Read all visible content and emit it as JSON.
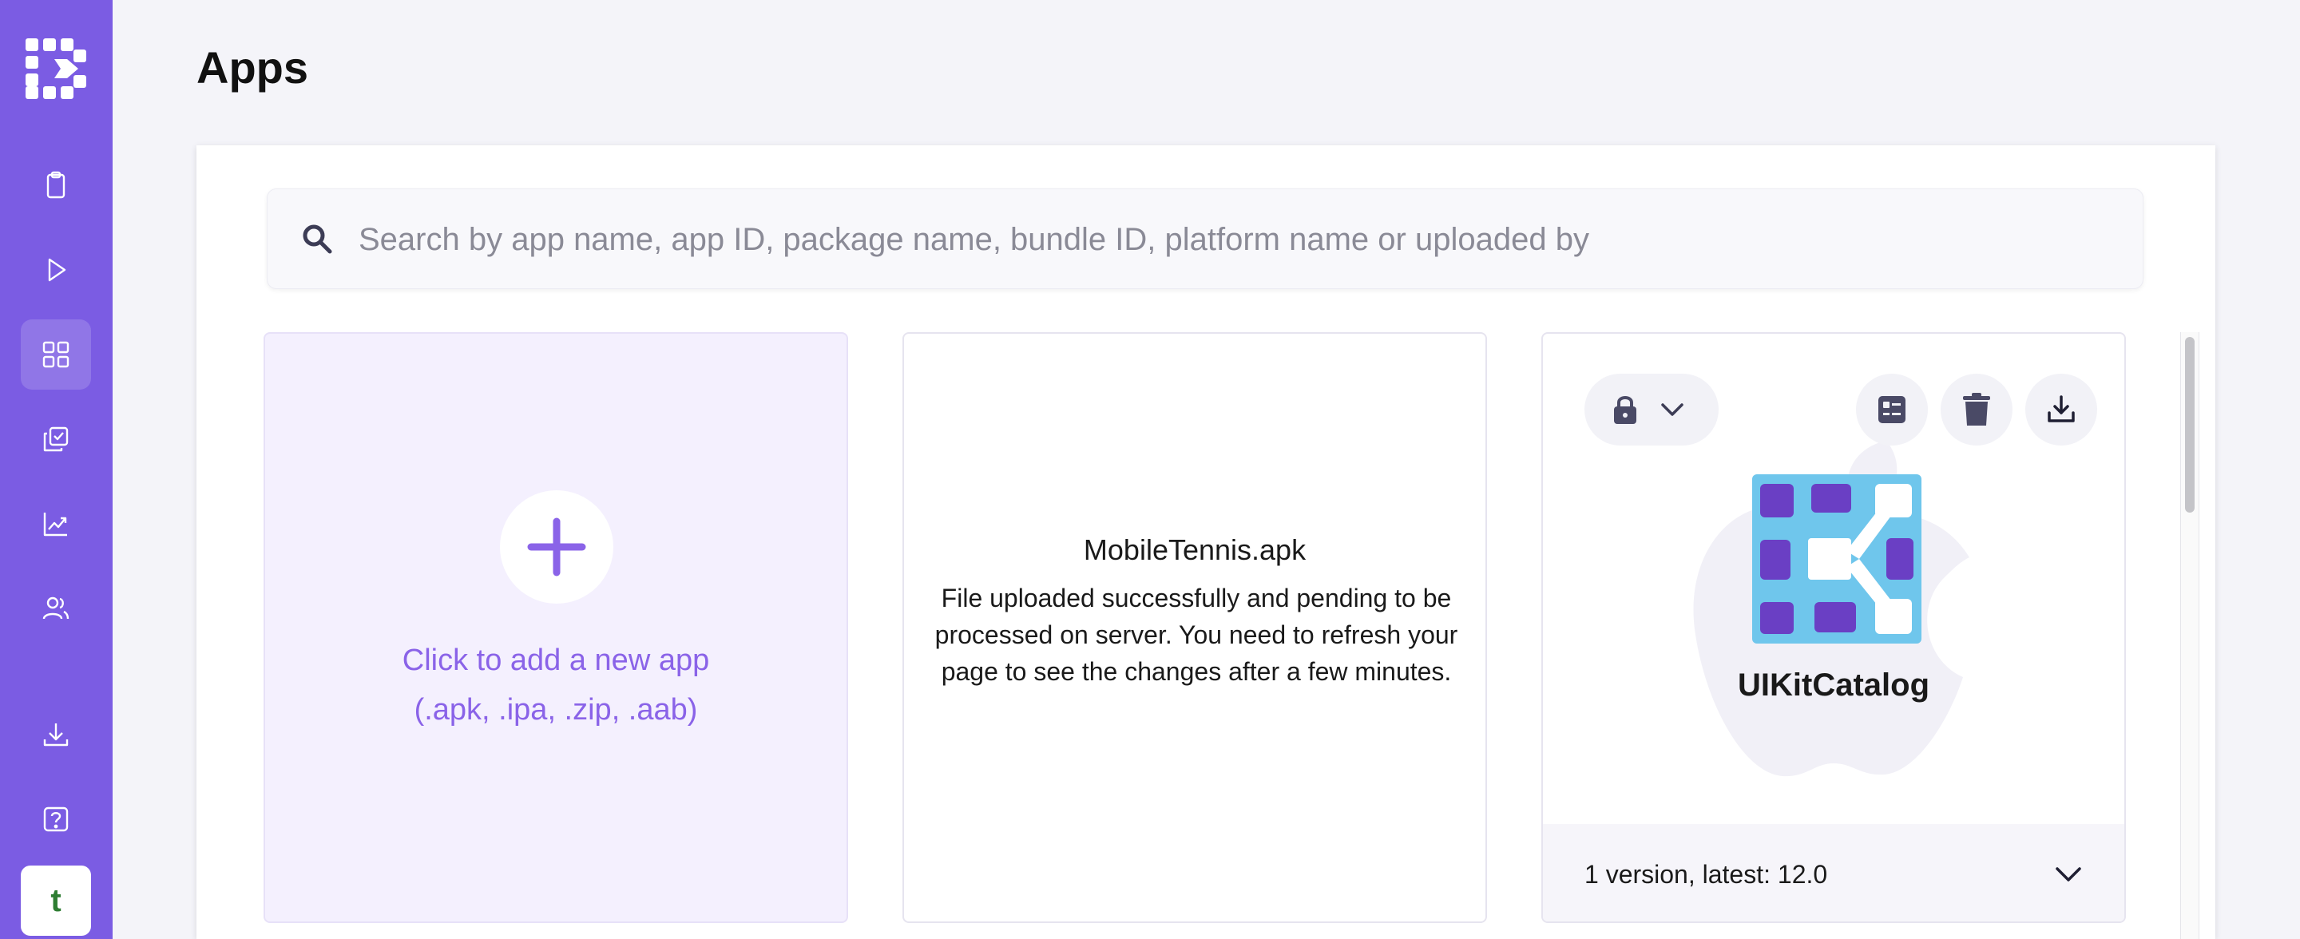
{
  "page": {
    "title": "Apps"
  },
  "sidebar": {
    "items": [
      {
        "name": "clipboard-icon"
      },
      {
        "name": "play-icon"
      },
      {
        "name": "apps-grid-icon",
        "active": true
      },
      {
        "name": "check-copy-icon"
      },
      {
        "name": "trending-chart-icon"
      },
      {
        "name": "users-icon"
      },
      {
        "name": "download-icon"
      },
      {
        "name": "help-icon"
      }
    ],
    "avatar": "t"
  },
  "search": {
    "placeholder": "Search by app name, app ID, package name, bundle ID, platform name or uploaded by"
  },
  "cards": {
    "add": {
      "label": "Click to add a new app",
      "sub": "(.apk, .ipa, .zip, .aab)"
    },
    "pending": {
      "name": "MobileTennis.apk",
      "message": "File uploaded successfully and pending to be processed on server. You need to refresh your page to see the changes after a few minutes."
    },
    "app": {
      "name": "UIKitCatalog",
      "platform_icon": "apple-icon",
      "versions": "1 version, latest: 12.0"
    }
  },
  "colors": {
    "sidebar": "#7b5ce3",
    "accent": "#8a63e8",
    "icon_bg": "#6fc6ec",
    "icon_tiles": "#6a3fc4"
  }
}
